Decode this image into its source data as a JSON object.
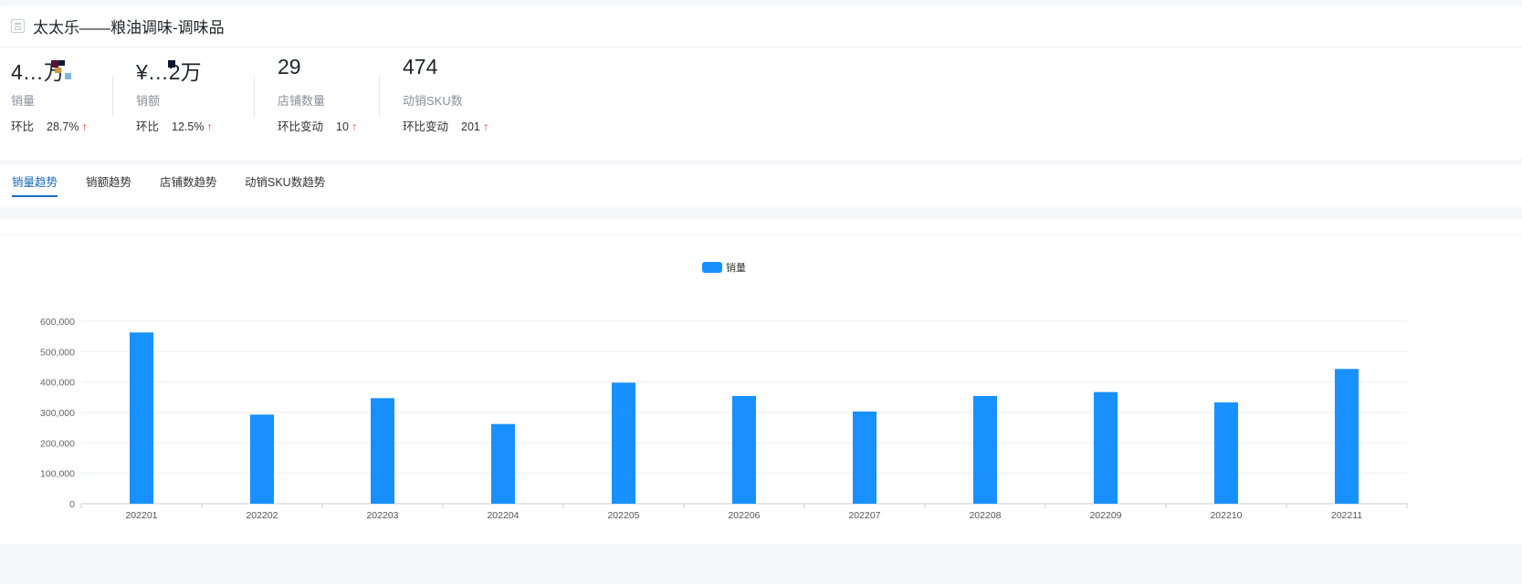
{
  "header": {
    "title": "太太乐——粮油调味-调味品",
    "title_icon": "document-icon"
  },
  "metrics": [
    {
      "value": "4…万",
      "label": "销量",
      "change_label": "环比",
      "change_value": "28.7%",
      "change_icon": "arrow-up-icon"
    },
    {
      "value": "¥…2万",
      "label": "销额",
      "change_label": "环比",
      "change_value": "12.5%",
      "change_icon": "arrow-up-icon"
    },
    {
      "value": "29",
      "label": "店铺数量",
      "change_label": "环比变动",
      "change_value": "10",
      "change_icon": "arrow-up-icon"
    },
    {
      "value": "474",
      "label": "动销SKU数",
      "change_label": "环比变动",
      "change_value": "201",
      "change_icon": "arrow-up-icon"
    }
  ],
  "tabs": [
    {
      "label": "销量趋势",
      "active": true
    },
    {
      "label": "销额趋势",
      "active": false
    },
    {
      "label": "店铺数趋势",
      "active": false
    },
    {
      "label": "动销SKU数趋势",
      "active": false
    }
  ],
  "colors": {
    "bar": "#1890ff",
    "accent": "#1a6bc0",
    "up_arrow": "#e8453c"
  },
  "chart_data": {
    "type": "bar",
    "categories": [
      "202201",
      "202202",
      "202203",
      "202204",
      "202205",
      "202206",
      "202207",
      "202208",
      "202209",
      "202210",
      "202211"
    ],
    "series": [
      {
        "name": "销量",
        "values": [
          563000,
          293000,
          347000,
          262000,
          398000,
          354000,
          303000,
          354000,
          367000,
          333000,
          443000
        ]
      }
    ],
    "ylim": [
      0,
      600000
    ],
    "yticks": [
      0,
      100000,
      200000,
      300000,
      400000,
      500000,
      600000
    ],
    "ytick_labels": [
      "0",
      "100,000",
      "200,000",
      "300,000",
      "400,000",
      "500,000",
      "600,000"
    ],
    "grid": true,
    "legend": "top-center"
  }
}
